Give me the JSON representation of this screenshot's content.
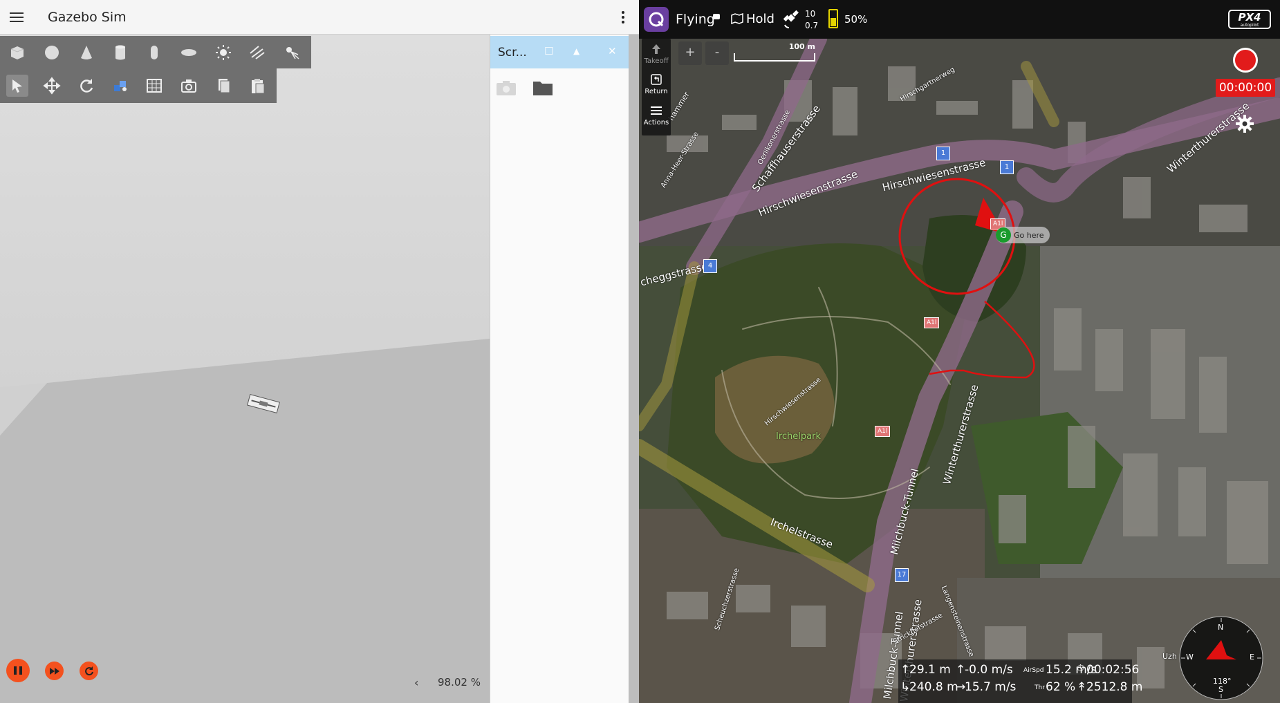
{
  "gazebo": {
    "title": "Gazebo Sim",
    "panel_title": "Scr...",
    "rtf_value": "98.02 %",
    "shape_tools": [
      "box-icon",
      "sphere-icon",
      "cone-icon",
      "cylinder-icon",
      "capsule-icon",
      "ellipsoid-icon",
      "sun-light-icon",
      "directional-light-icon",
      "spot-light-icon"
    ],
    "transform_tools": [
      "select-icon",
      "translate-icon",
      "rotate-icon",
      "snap-icon",
      "grid-icon",
      "camera-icon",
      "copy-icon",
      "paste-icon"
    ]
  },
  "qgc": {
    "flight_state": "Flying",
    "flight_mode": "Hold",
    "gps_sat_count": "10",
    "gps_hdop": "0.7",
    "battery_percent": "50%",
    "brand": "PX4",
    "brand_sub": "autopilot",
    "toolstrip": {
      "takeoff": "Takeoff",
      "return": "Return",
      "actions": "Actions"
    },
    "zoom_in": "+",
    "zoom_out": "-",
    "scale_label": "100 m",
    "recording_timer": "00:00:00",
    "go_here_marker": "G",
    "go_here_label": "Go here",
    "park_label": "Irchelpark",
    "street_labels": {
      "hirschwiesenstrasse_1": "Hirschwiesenstrasse",
      "hirschwiesenstrasse_2": "Hirschwiesenstrasse",
      "hirschwiesenstrasse_3": "Hirschwiesenstrasse",
      "schaffhauserstrasse": "Schaffhauserstrasse",
      "winterthurerstrasse_1": "Winterthurerstrasse",
      "winterthurerstrasse_2": "Winterthurerstrasse",
      "irchelstrasse": "Irchelstrasse",
      "milchbuck_tunnel_1": "Milchbuck-Tunnel",
      "milchbuck_tunnel_2": "Milchbuck-Tunnel",
      "hirschgartnerweg": "Hirschgartnerweg",
      "oerlikonerstrasse": "Oerlikonerstrasse",
      "anna_heer_strasse": "Anna-Heer-Strasse",
      "scheuchzerstrasse": "Scheuchzerstrasse",
      "langensteinenstrasse": "Langensteinenstrasse",
      "strickhofstrasse": "Strickhofstrasse",
      "rotbuchstrasse_fragment": "cheggstrasse",
      "hammer_fragment": "hammer",
      "winterthurerstrasse_3": "Winterthurerstrasse"
    },
    "route_markers": [
      "1",
      "1",
      "4",
      "17",
      "A1l",
      "A1l",
      "A1l"
    ],
    "telemetry": {
      "altitude": "29.1 m",
      "vertical_speed": "-0.0 m/s",
      "airspeed_label": "AirSpd",
      "airspeed": "15.2 m/s",
      "flight_time": "00:02:56",
      "distance_home": "240.8 m",
      "ground_speed": "15.7 m/s",
      "throttle_label": "Thr",
      "throttle": "62 %",
      "distance_traveled": "2512.8 m"
    },
    "compass": {
      "n": "N",
      "s": "S",
      "e": "E",
      "w": "W",
      "heading": "118°"
    },
    "map_fragment_uzh": "Uzh"
  }
}
